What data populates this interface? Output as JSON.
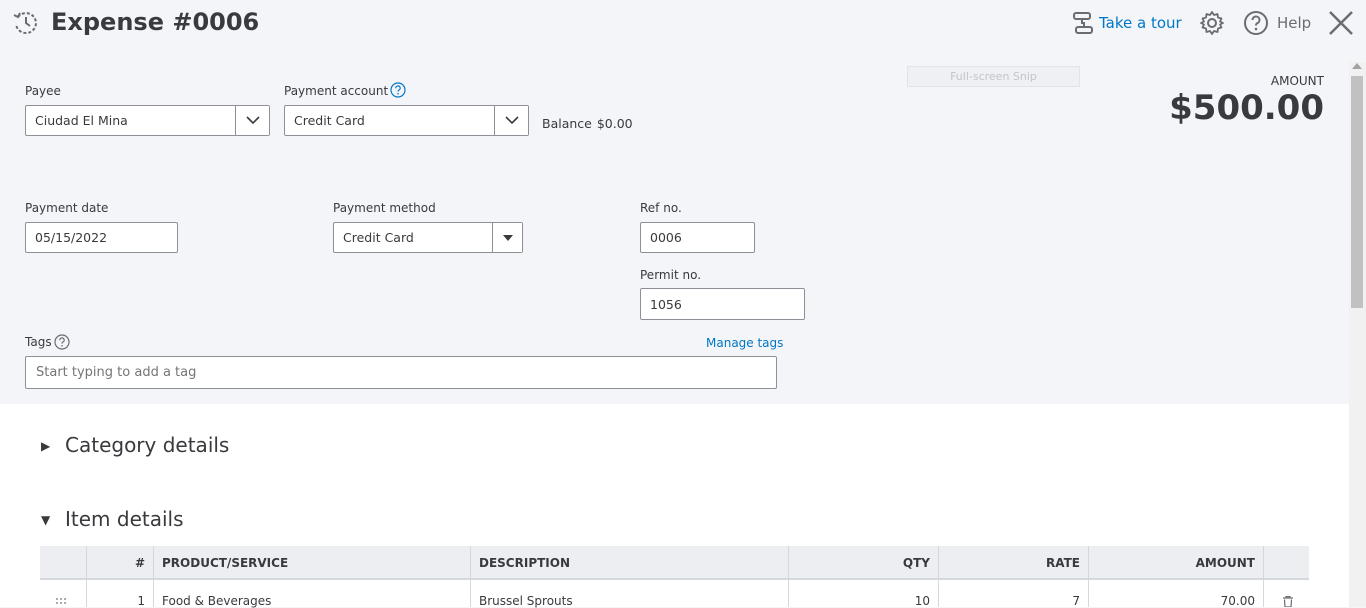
{
  "header": {
    "title": "Expense #0006",
    "take_tour": "Take a tour",
    "help": "Help"
  },
  "form": {
    "payee": {
      "label": "Payee",
      "value": "Ciudad El Mina"
    },
    "payment_account": {
      "label": "Payment account",
      "value": "Credit Card"
    },
    "balance": {
      "label": "Balance",
      "value": "$0.00"
    },
    "payment_date": {
      "label": "Payment date",
      "value": "05/15/2022"
    },
    "payment_method": {
      "label": "Payment method",
      "value": "Credit Card"
    },
    "ref_no": {
      "label": "Ref no.",
      "value": "0006"
    },
    "permit_no": {
      "label": "Permit no.",
      "value": "1056"
    },
    "tags": {
      "label": "Tags",
      "placeholder": "Start typing to add a tag",
      "manage": "Manage tags"
    }
  },
  "overlay": {
    "snip_label": "Full-screen Snip"
  },
  "amount": {
    "label": "AMOUNT",
    "value": "$500.00"
  },
  "sections": {
    "category": {
      "toggle": "▶",
      "title": "Category details"
    },
    "item": {
      "toggle": "▼",
      "title": "Item details"
    }
  },
  "item_table": {
    "headers": {
      "num": "#",
      "product": "PRODUCT/SERVICE",
      "description": "DESCRIPTION",
      "qty": "QTY",
      "rate": "RATE",
      "amount": "AMOUNT"
    },
    "rows": [
      {
        "num": "1",
        "product": "Food & Beverages",
        "description": "Brussel Sprouts",
        "qty": "10",
        "rate": "7",
        "amount": "70.00"
      }
    ]
  },
  "colors": {
    "link": "#0077c5",
    "text": "#393a3d",
    "background": "#f4f5f8"
  },
  "icons": [
    "recent-transactions-icon",
    "take-tour-icon",
    "gear-icon",
    "help-icon",
    "close-icon",
    "chevron-down-icon",
    "caret-down-icon",
    "drag-handle-icon",
    "trash-icon"
  ]
}
